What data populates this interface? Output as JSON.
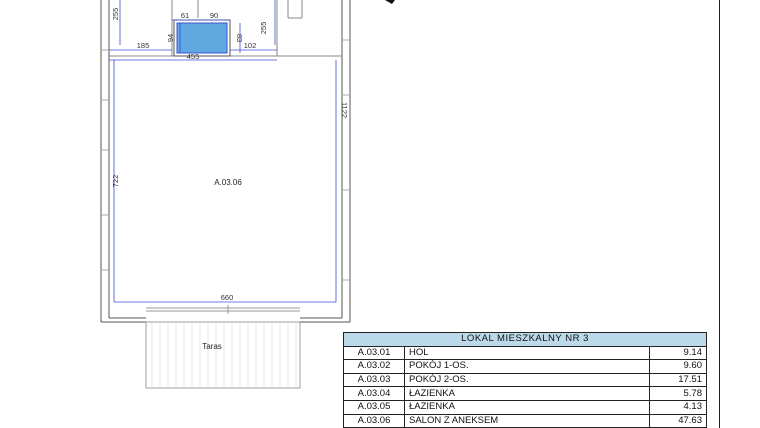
{
  "plan": {
    "room_code": "A.03.06",
    "terrace_label": "Taras",
    "dimensions": {
      "top_left_vertical": "255",
      "top_right_vertical": "255",
      "window_left": "61",
      "window_width": "90",
      "window_left_height": "94",
      "window_right_height": "83",
      "left_offset": "185",
      "right_offset": "102",
      "top_width": "455",
      "right_height": "1122",
      "left_height": "722",
      "bottom_width": "660"
    }
  },
  "table": {
    "title": "LOKAL MIESZKALNY NR 3",
    "rows": [
      {
        "code": "A.03.01",
        "name": "HOL",
        "area": "9.14"
      },
      {
        "code": "A.03.02",
        "name": "POKÓJ 1-OS.",
        "area": "9.60"
      },
      {
        "code": "A.03.03",
        "name": "POKÓJ 2-OS.",
        "area": "17.51"
      },
      {
        "code": "A.03.04",
        "name": "ŁAZIENKA",
        "area": "5.78"
      },
      {
        "code": "A.03.05",
        "name": "ŁAZIENKA",
        "area": "4.13"
      },
      {
        "code": "A.03.06",
        "name": "SALON Z ANEKSEM",
        "area": "47.63"
      }
    ]
  },
  "colors": {
    "dimension_line": "#3b4fd6",
    "fixture_fill": "#5fa8e0",
    "table_header": "#bcd9ea"
  }
}
